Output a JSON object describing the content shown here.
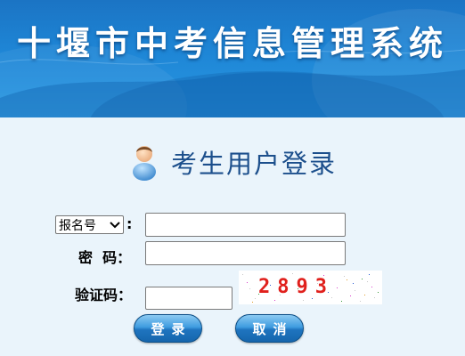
{
  "banner": {
    "title": "十堰市中考信息管理系统"
  },
  "login": {
    "title": "考生用户登录",
    "icon": "user-icon"
  },
  "form": {
    "id_type_selected": "报名号",
    "id_type_colon": ":",
    "id_value": "",
    "password_label": "密  码：",
    "password_value": "",
    "captcha_label": "验证码：",
    "captcha_value": "",
    "captcha_image_text": "2893"
  },
  "buttons": {
    "login_label": "登录",
    "cancel_label": "取消"
  },
  "colors": {
    "banner": "#1e86d6",
    "page_background": "#eaf4fb",
    "title_text": "#1c4f8c",
    "button": "#1f74bf",
    "captcha_text": "#e0201c"
  }
}
